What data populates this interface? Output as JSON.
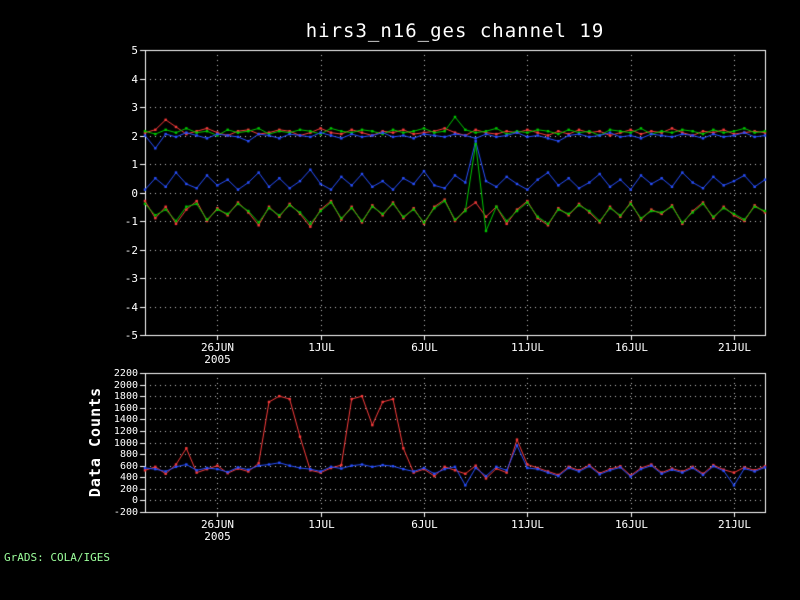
{
  "title": "hirs3_n16_ges channel 19",
  "credit": "GrADS: COLA/IGES",
  "colors": {
    "background": "#000000",
    "axis": "#ffffff",
    "grid": "#c8c8c8",
    "text": "#ffffff",
    "credit": "#9cff9c",
    "red": "#fa3c3c",
    "green": "#00c800",
    "blue": "#2850ff"
  },
  "chart_data": [
    {
      "type": "line",
      "title": "hirs3_n16_ges channel 19",
      "xlabel": "",
      "ylabel": "",
      "ylim": [
        -5,
        5
      ],
      "yticks": [
        5,
        4,
        3,
        2,
        1,
        0,
        -1,
        -2,
        -3,
        -4,
        -5
      ],
      "xlim": [
        0,
        30
      ],
      "x_start": 0,
      "x_step": 0.5,
      "grid": true,
      "legend": "none",
      "xticks": [
        {
          "label": "26JUN",
          "day": 3.5,
          "sub": "2005"
        },
        {
          "label": "1JUL",
          "day": 8.5
        },
        {
          "label": "6JUL",
          "day": 13.5
        },
        {
          "label": "11JUL",
          "day": 18.5
        },
        {
          "label": "16JUL",
          "day": 23.5
        },
        {
          "label": "21JUL",
          "day": 28.5
        }
      ],
      "series": [
        {
          "name": "series-red-upper",
          "color": "#fa3c3c",
          "values": [
            2.1,
            2.2,
            2.55,
            2.3,
            2.05,
            2.15,
            2.25,
            2.1,
            2.0,
            2.15,
            2.2,
            2.05,
            2.1,
            2.2,
            2.15,
            2.0,
            2.1,
            2.25,
            2.1,
            2.05,
            2.2,
            2.1,
            2.0,
            2.15,
            2.1,
            2.2,
            2.05,
            2.1,
            2.15,
            2.25,
            2.1,
            2.0,
            2.2,
            2.1,
            2.05,
            2.15,
            2.1,
            2.2,
            2.1,
            2.0,
            2.15,
            2.05,
            2.2,
            2.1,
            2.15,
            2.0,
            2.1,
            2.2,
            2.05,
            2.15,
            2.1,
            2.25,
            2.1,
            2.0,
            2.15,
            2.1,
            2.2,
            2.05,
            2.1,
            2.15,
            2.1
          ]
        },
        {
          "name": "series-green-upper",
          "color": "#00c800",
          "values": [
            2.15,
            2.05,
            2.2,
            2.1,
            2.25,
            2.1,
            2.15,
            2.0,
            2.2,
            2.1,
            2.15,
            2.25,
            2.05,
            2.15,
            2.1,
            2.2,
            2.15,
            2.05,
            2.25,
            2.15,
            2.1,
            2.2,
            2.15,
            2.05,
            2.2,
            2.1,
            2.15,
            2.25,
            2.1,
            2.15,
            2.65,
            2.2,
            2.1,
            2.15,
            2.25,
            2.05,
            2.15,
            2.1,
            2.2,
            2.15,
            2.05,
            2.2,
            2.1,
            2.15,
            2.0,
            2.2,
            2.15,
            2.1,
            2.25,
            2.05,
            2.15,
            2.1,
            2.2,
            2.15,
            2.05,
            2.2,
            2.1,
            2.15,
            2.25,
            2.1,
            2.15
          ]
        },
        {
          "name": "series-blue-upper",
          "color": "#2850ff",
          "values": [
            2.0,
            1.55,
            2.05,
            1.95,
            2.1,
            2.0,
            1.9,
            2.05,
            2.0,
            1.95,
            1.8,
            2.05,
            2.0,
            1.9,
            2.05,
            2.0,
            1.95,
            2.1,
            2.0,
            1.9,
            2.05,
            1.95,
            2.0,
            2.1,
            1.95,
            2.0,
            1.9,
            2.05,
            2.0,
            1.95,
            2.05,
            2.0,
            1.9,
            2.05,
            1.95,
            2.0,
            2.1,
            1.95,
            2.0,
            1.9,
            1.8,
            2.0,
            2.05,
            1.95,
            2.0,
            2.1,
            1.95,
            2.0,
            1.9,
            2.05,
            2.0,
            1.95,
            2.05,
            2.0,
            1.9,
            2.05,
            1.95,
            2.0,
            2.1,
            1.95,
            2.0
          ]
        },
        {
          "name": "series-blue-mid",
          "color": "#2850ff",
          "values": [
            0.1,
            0.5,
            0.2,
            0.7,
            0.3,
            0.15,
            0.6,
            0.25,
            0.45,
            0.1,
            0.35,
            0.7,
            0.2,
            0.5,
            0.15,
            0.4,
            0.8,
            0.3,
            0.1,
            0.55,
            0.25,
            0.65,
            0.2,
            0.4,
            0.1,
            0.5,
            0.3,
            0.75,
            0.25,
            0.15,
            0.6,
            0.35,
            1.8,
            0.4,
            0.2,
            0.55,
            0.3,
            0.1,
            0.45,
            0.7,
            0.25,
            0.5,
            0.15,
            0.35,
            0.65,
            0.2,
            0.45,
            0.1,
            0.6,
            0.3,
            0.5,
            0.2,
            0.7,
            0.35,
            0.15,
            0.55,
            0.25,
            0.4,
            0.6,
            0.2,
            0.45
          ]
        },
        {
          "name": "series-red-lower",
          "color": "#fa3c3c",
          "values": [
            -0.3,
            -0.9,
            -0.5,
            -1.1,
            -0.6,
            -0.3,
            -1.0,
            -0.55,
            -0.8,
            -0.35,
            -0.7,
            -1.15,
            -0.5,
            -0.85,
            -0.4,
            -0.75,
            -1.2,
            -0.6,
            -0.3,
            -0.95,
            -0.5,
            -1.05,
            -0.45,
            -0.8,
            -0.35,
            -0.9,
            -0.55,
            -1.1,
            -0.5,
            -0.25,
            -1.0,
            -0.6,
            -0.35,
            -0.85,
            -0.5,
            -1.1,
            -0.6,
            -0.3,
            -0.9,
            -1.15,
            -0.55,
            -0.8,
            -0.4,
            -0.7,
            -1.05,
            -0.5,
            -0.85,
            -0.35,
            -0.95,
            -0.6,
            -0.75,
            -0.45,
            -1.1,
            -0.65,
            -0.35,
            -0.9,
            -0.5,
            -0.8,
            -1.0,
            -0.45,
            -0.7
          ]
        },
        {
          "name": "series-green-lower",
          "color": "#00c800",
          "values": [
            -0.4,
            -0.8,
            -0.6,
            -1.0,
            -0.5,
            -0.4,
            -0.95,
            -0.6,
            -0.75,
            -0.4,
            -0.65,
            -1.05,
            -0.55,
            -0.8,
            -0.45,
            -0.7,
            -1.1,
            -0.65,
            -0.35,
            -0.9,
            -0.55,
            -1.0,
            -0.5,
            -0.75,
            -0.4,
            -0.85,
            -0.6,
            -1.05,
            -0.55,
            -0.3,
            -0.95,
            -0.65,
            1.7,
            -1.35,
            -0.5,
            -1.0,
            -0.65,
            -0.35,
            -0.85,
            -1.1,
            -0.6,
            -0.75,
            -0.45,
            -0.65,
            -1.0,
            -0.55,
            -0.8,
            -0.4,
            -0.9,
            -0.65,
            -0.7,
            -0.5,
            -1.05,
            -0.7,
            -0.4,
            -0.85,
            -0.55,
            -0.75,
            -0.95,
            -0.5,
            -0.65
          ]
        }
      ]
    },
    {
      "type": "line",
      "title": "",
      "xlabel": "",
      "ylabel": "Data Counts",
      "ylim": [
        -200,
        2200
      ],
      "yticks": [
        2200,
        2000,
        1800,
        1600,
        1400,
        1200,
        1000,
        800,
        600,
        400,
        200,
        0,
        -200
      ],
      "xlim": [
        0,
        30
      ],
      "x_start": 0,
      "x_step": 0.5,
      "grid": true,
      "legend": "none",
      "xticks": [
        {
          "label": "26JUN",
          "day": 3.5,
          "sub": "2005"
        },
        {
          "label": "1JUL",
          "day": 8.5
        },
        {
          "label": "6JUL",
          "day": 13.5
        },
        {
          "label": "11JUL",
          "day": 18.5
        },
        {
          "label": "16JUL",
          "day": 23.5
        },
        {
          "label": "21JUL",
          "day": 28.5
        }
      ],
      "series": [
        {
          "name": "series-red-counts",
          "color": "#fa3c3c",
          "values": [
            520,
            580,
            460,
            620,
            900,
            480,
            540,
            600,
            470,
            550,
            500,
            640,
            1700,
            1800,
            1750,
            1100,
            520,
            480,
            560,
            610,
            1750,
            1800,
            1300,
            1700,
            1750,
            900,
            480,
            540,
            420,
            580,
            520,
            460,
            600,
            380,
            550,
            480,
            1050,
            620,
            560,
            500,
            440,
            580,
            520,
            610,
            470,
            540,
            590,
            430,
            560,
            620,
            480,
            550,
            500,
            580,
            460,
            610,
            530,
            480,
            570,
            520,
            590
          ]
        },
        {
          "name": "series-blue-counts",
          "color": "#2850ff",
          "values": [
            560,
            540,
            500,
            580,
            620,
            520,
            560,
            540,
            490,
            570,
            530,
            600,
            620,
            650,
            600,
            560,
            540,
            500,
            580,
            550,
            600,
            620,
            580,
            610,
            590,
            540,
            500,
            560,
            460,
            540,
            580,
            260,
            560,
            420,
            580,
            520,
            950,
            560,
            540,
            480,
            420,
            560,
            500,
            590,
            450,
            520,
            570,
            410,
            540,
            600,
            460,
            530,
            480,
            560,
            440,
            590,
            510,
            260,
            550,
            500,
            570
          ]
        }
      ]
    }
  ]
}
